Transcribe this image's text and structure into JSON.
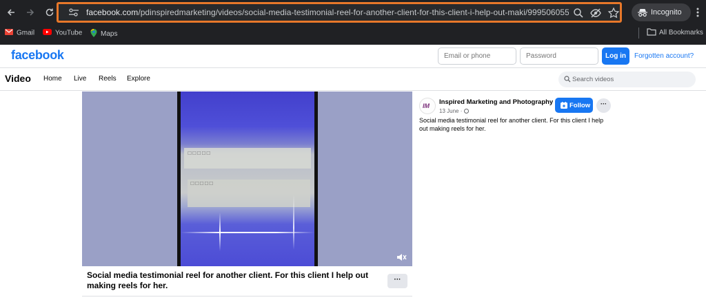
{
  "browser": {
    "url_domain": "facebook.com",
    "url_path": "/pdinspiredmarketing/videos/social-media-testimonial-reel-for-another-client-for-this-client-i-help-out-maki/99950605578...",
    "incognito_label": "Incognito",
    "bookmarks": [
      {
        "label": "Gmail"
      },
      {
        "label": "YouTube"
      },
      {
        "label": "Maps"
      }
    ],
    "all_bookmarks_label": "All Bookmarks",
    "colors": {
      "frame": "#202124",
      "highlight": "#e8782a"
    }
  },
  "fb_header": {
    "logo": "facebook",
    "email_placeholder": "Email or phone",
    "password_placeholder": "Password",
    "login_label": "Log in",
    "forgot_label": "Forgotten account?",
    "brand_color": "#1877f2"
  },
  "video_nav": {
    "title": "Video",
    "tabs": [
      {
        "label": "Home"
      },
      {
        "label": "Live"
      },
      {
        "label": "Reels"
      },
      {
        "label": "Explore"
      }
    ],
    "search_placeholder": "Search videos"
  },
  "post": {
    "caption": "Social media testimonial reel for another client. For this client I help out making reels for her.",
    "more_label": "···",
    "page_avatar_text": "IM",
    "page_name": "Inspired Marketing and Photography",
    "date": "13 June ·",
    "follow_label": "Follow",
    "side_more_label": "···",
    "description": "Social media testimonial reel for another client. For this client I help out making reels for her."
  }
}
